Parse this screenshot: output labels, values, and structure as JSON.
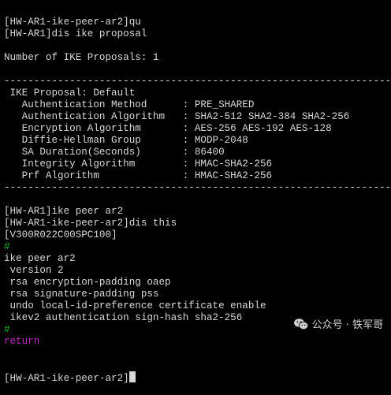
{
  "terminal": {
    "lines": [
      {
        "text": "[HW-AR1-ike-peer-ar2]qu",
        "kind": "normal"
      },
      {
        "text": "[HW-AR1]dis ike proposal",
        "kind": "normal"
      },
      {
        "text": "",
        "kind": "blank"
      },
      {
        "text": "Number of IKE Proposals: 1",
        "kind": "normal"
      },
      {
        "text": "",
        "kind": "blank"
      },
      {
        "text": "-------------------------------------------------------------------",
        "kind": "normal"
      },
      {
        "text": " IKE Proposal: Default",
        "kind": "normal"
      },
      {
        "text": "   Authentication Method      : PRE_SHARED",
        "kind": "normal"
      },
      {
        "text": "   Authentication Algorithm   : SHA2-512 SHA2-384 SHA2-256",
        "kind": "normal"
      },
      {
        "text": "   Encryption Algorithm       : AES-256 AES-192 AES-128",
        "kind": "normal"
      },
      {
        "text": "   Diffie-Hellman Group       : MODP-2048",
        "kind": "normal"
      },
      {
        "text": "   SA Duration(Seconds)       : 86400",
        "kind": "normal"
      },
      {
        "text": "   Integrity Algorithm        : HMAC-SHA2-256",
        "kind": "normal"
      },
      {
        "text": "   Prf Algorithm              : HMAC-SHA2-256",
        "kind": "normal"
      },
      {
        "text": "-------------------------------------------------------------------",
        "kind": "normal"
      },
      {
        "text": "",
        "kind": "blank"
      },
      {
        "text": "[HW-AR1]ike peer ar2",
        "kind": "normal"
      },
      {
        "text": "[HW-AR1-ike-peer-ar2]dis this",
        "kind": "normal"
      },
      {
        "text": "[V300R022C00SPC100]",
        "kind": "normal"
      },
      {
        "text": "#",
        "kind": "hash"
      },
      {
        "text": "ike peer ar2",
        "kind": "normal"
      },
      {
        "text": " version 2",
        "kind": "normal"
      },
      {
        "text": " rsa encryption-padding oaep",
        "kind": "normal"
      },
      {
        "text": " rsa signature-padding pss",
        "kind": "normal"
      },
      {
        "text": " undo local-id-preference certificate enable",
        "kind": "normal"
      },
      {
        "text": " ikev2 authentication sign-hash sha2-256",
        "kind": "normal"
      },
      {
        "text": "#",
        "kind": "hash"
      },
      {
        "text": "return",
        "kind": "return"
      }
    ],
    "prompt": "[HW-AR1-ike-peer-ar2]"
  },
  "watermark": {
    "text": "公众号 · 铁军哥",
    "icon": "wechat-icon"
  },
  "colors": {
    "background": "#000000",
    "text": "#d8d8d8",
    "hash": "#19c219",
    "return": "#c228c2"
  }
}
